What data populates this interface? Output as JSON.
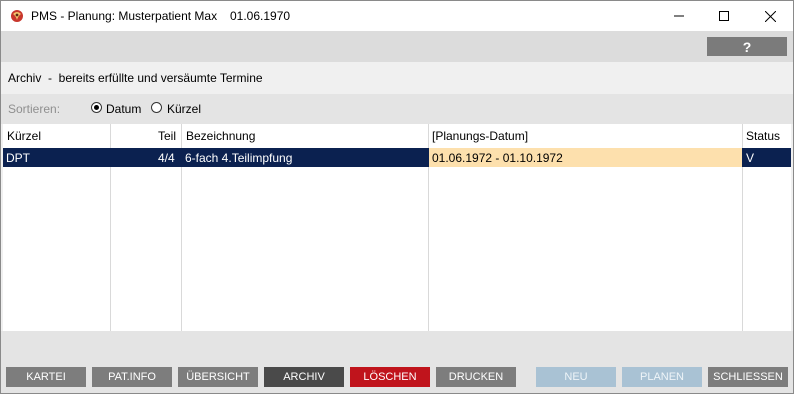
{
  "window": {
    "title": "PMS - Planung: Musterpatient Max",
    "birth_date": "01.06.1970",
    "controls": {
      "minimize_icon": "minimize-icon",
      "maximize_icon": "maximize-icon",
      "close_icon": "close-icon"
    }
  },
  "help": {
    "label": "?"
  },
  "archive": {
    "title": "Archiv  -  bereits erfüllte und versäumte Termine"
  },
  "sort": {
    "label": "Sortieren:",
    "options": [
      {
        "label": "Datum",
        "selected": true
      },
      {
        "label": "Kürzel",
        "selected": false
      }
    ]
  },
  "table": {
    "headers": {
      "kuerzel": "Kürzel",
      "teil": "Teil",
      "bezeichnung": "Bezeichnung",
      "datum": "[Planungs-Datum]",
      "status": "Status"
    },
    "rows": [
      {
        "kuerzel": "DPT",
        "teil": "4/4",
        "bezeichnung": "6-fach 4.Teilimpfung",
        "datum": "01.06.1972 - 01.10.1972",
        "status": "V",
        "selected": true
      }
    ]
  },
  "buttons": {
    "kartei": "KARTEI",
    "patinfo": "PAT.INFO",
    "uebersicht": "ÜBERSICHT",
    "archiv": "ARCHIV",
    "loeschen": "LÖSCHEN",
    "drucken": "DRUCKEN",
    "neu": "NEU",
    "planen": "PLANEN",
    "schliessen": "SCHLIESSEN"
  },
  "colors": {
    "selected_row": "#0b2150",
    "date_highlight": "#fde0ad",
    "delete_button": "#c0141c",
    "active_button": "#4a4a4a",
    "disabled_button": "#a9c2d4"
  }
}
